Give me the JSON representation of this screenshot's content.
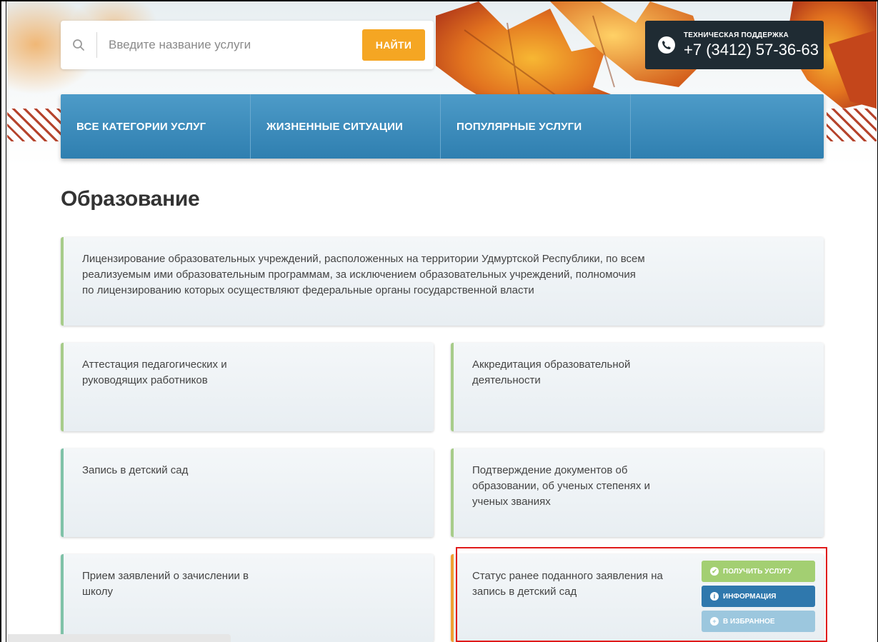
{
  "search": {
    "placeholder": "Введите название услуги",
    "button_label": "НАЙТИ"
  },
  "support": {
    "label": "ТЕХНИЧЕСКАЯ ПОДДЕРЖКА",
    "phone": "+7 (3412) 57-36-63"
  },
  "nav": {
    "items": [
      {
        "label": "ВСЕ КАТЕГОРИИ УСЛУГ"
      },
      {
        "label": "ЖИЗНЕННЫЕ СИТУАЦИИ"
      },
      {
        "label": "ПОПУЛЯРНЫЕ УСЛУГИ"
      },
      {
        "label": ""
      }
    ]
  },
  "page_title": "Образование",
  "services": [
    {
      "text": "Лицензирование образовательных учреждений, расположенных на территории Удмуртской Республики, по всем\nреализуемым ими образовательным программам, за исключением образовательных учреждений, полномочия\nпо лицензированию которых осуществляют федеральные органы государственной власти"
    },
    {
      "text": "Аттестация педагогических и\nруководящих работников"
    },
    {
      "text": "Аккредитация образовательной\nдеятельности"
    },
    {
      "text": "Запись в детский сад"
    },
    {
      "text": "Подтверждение документов об\nобразовании, об ученых степенях и\nученых званиях"
    },
    {
      "text": "Прием заявлений о зачислении в\nшколу"
    },
    {
      "text": "Статус ранее поданного заявления на\nзапись в детский сад"
    }
  ],
  "actions": {
    "get_service": "ПОЛУЧИТЬ УСЛУГУ",
    "info": "ИНФОРМАЦИЯ",
    "favorite": "В ИЗБРАННОЕ"
  },
  "colors": {
    "accent_orange": "#f5a623",
    "nav_blue": "#2f7fb0",
    "highlight_red": "#e01b1b"
  }
}
